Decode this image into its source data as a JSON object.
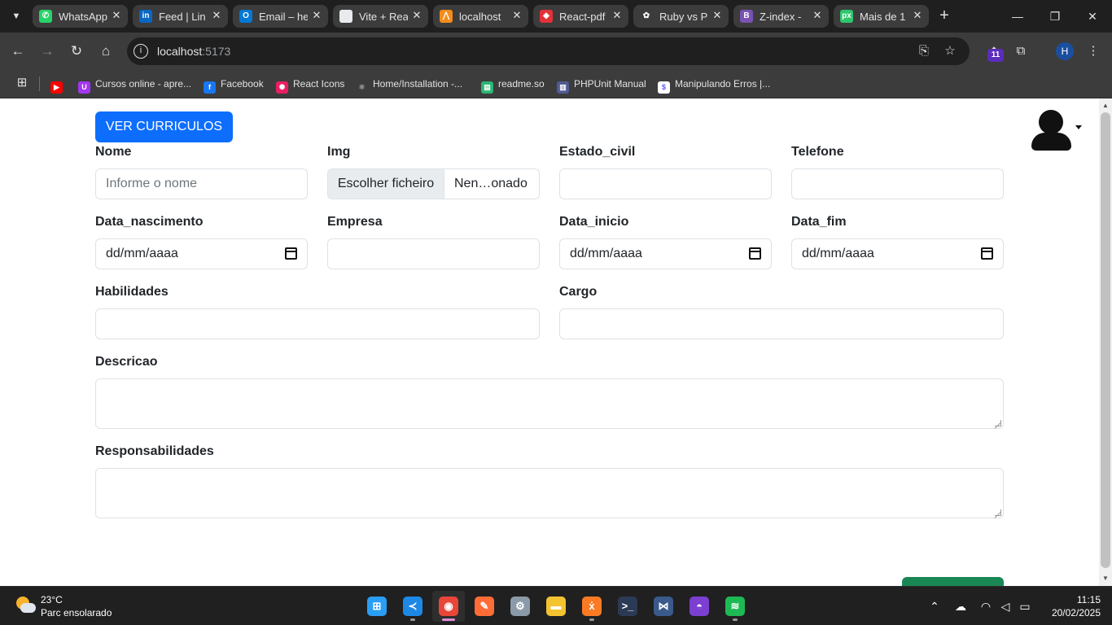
{
  "browser": {
    "tabs": [
      {
        "label": "WhatsApp",
        "icon": "whatsapp-icon",
        "color": "#25d366",
        "glyph": "✆"
      },
      {
        "label": "Feed | Lin",
        "icon": "linkedin-icon",
        "color": "#0a66c2",
        "glyph": "in"
      },
      {
        "label": "Email – he",
        "icon": "outlook-icon",
        "color": "#0078d4",
        "glyph": "O"
      },
      {
        "label": "Vite + Rea",
        "icon": "page-icon",
        "color": "#e8eaed",
        "glyph": ""
      },
      {
        "label": "localhost",
        "icon": "xampp-icon",
        "color": "#f28c1d",
        "glyph": "⋀"
      },
      {
        "label": "React-pdf",
        "icon": "react-pdf-icon",
        "color": "#e23237",
        "glyph": "◆"
      },
      {
        "label": "Ruby vs P",
        "icon": "openai-icon",
        "color": "#3c3c3c",
        "glyph": "✿"
      },
      {
        "label": "Z-index -",
        "icon": "bootstrap-icon",
        "color": "#7952b3",
        "glyph": "B"
      },
      {
        "label": "Mais de 1",
        "icon": "pixabay-icon",
        "color": "#2ec66d",
        "glyph": "px"
      }
    ],
    "url_host": "localhost",
    "url_port": ":5173",
    "extension_badge": "11",
    "profile_initial": "H",
    "bookmarks": [
      {
        "label": "",
        "icon": "youtube-icon",
        "color": "#ff0000",
        "glyph": "▶"
      },
      {
        "label": "Cursos online - apre...",
        "icon": "udemy-icon",
        "color": "#a435f0",
        "glyph": "U"
      },
      {
        "label": "Facebook",
        "icon": "facebook-icon",
        "color": "#1877f2",
        "glyph": "f"
      },
      {
        "label": "React Icons",
        "icon": "react-icons-icon",
        "color": "#e91e63",
        "glyph": "✺"
      },
      {
        "label": "Home/Installation -...",
        "icon": "react-icon",
        "color": "#3c3c3c",
        "glyph": "⚛"
      },
      {
        "label": "readme.so",
        "icon": "readme-icon",
        "color": "#2bb673",
        "glyph": "▤"
      },
      {
        "label": "PHPUnit Manual",
        "icon": "phpunit-icon",
        "color": "#4f5b93",
        "glyph": "▥"
      },
      {
        "label": "Manipulando Erros |...",
        "icon": "stripe-icon",
        "color": "#ffffff",
        "glyph": "$"
      }
    ]
  },
  "page": {
    "ver_curriculos_button": "VER CURRICULOS",
    "fields": {
      "nome": {
        "label": "Nome",
        "placeholder": "Informe o nome"
      },
      "img": {
        "label": "Img",
        "button": "Escolher ficheiro",
        "filename": "Nen…onado"
      },
      "estado_civil": {
        "label": "Estado_civil"
      },
      "telefone": {
        "label": "Telefone"
      },
      "data_nascimento": {
        "label": "Data_nascimento",
        "value": "dd/mm/aaaa"
      },
      "empresa": {
        "label": "Empresa"
      },
      "data_inicio": {
        "label": "Data_inicio",
        "value": "dd/mm/aaaa"
      },
      "data_fim": {
        "label": "Data_fim",
        "value": "dd/mm/aaaa"
      },
      "habilidades": {
        "label": "Habilidades"
      },
      "cargo": {
        "label": "Cargo"
      },
      "descricao": {
        "label": "Descricao"
      },
      "responsabilidades": {
        "label": "Responsabilidades"
      }
    },
    "colors": {
      "primary": "#0d6efd",
      "success": "#198754"
    }
  },
  "taskbar": {
    "weather_temp": "23°C",
    "weather_desc": "Parc ensolarado",
    "apps": [
      {
        "name": "windows-start-icon",
        "color": "#2a9df4",
        "glyph": "⊞"
      },
      {
        "name": "vscode-icon",
        "color": "#1e88e5",
        "glyph": "≺"
      },
      {
        "name": "chrome-icon",
        "color": "#e9463a",
        "glyph": "◉"
      },
      {
        "name": "postman-icon",
        "color": "#ff6c37",
        "glyph": "✎"
      },
      {
        "name": "settings-icon",
        "color": "#8a9aa8",
        "glyph": "⚙"
      },
      {
        "name": "file-explorer-icon",
        "color": "#f4c430",
        "glyph": "▬"
      },
      {
        "name": "xampp-icon",
        "color": "#fb7a24",
        "glyph": "ẋ"
      },
      {
        "name": "powershell-icon",
        "color": "#2b3a55",
        "glyph": ">_"
      },
      {
        "name": "mysql-workbench-icon",
        "color": "#3a5a8c",
        "glyph": "⋈"
      },
      {
        "name": "github-desktop-icon",
        "color": "#7b3fd1",
        "glyph": "◓"
      },
      {
        "name": "spotify-icon",
        "color": "#1db954",
        "glyph": "≋"
      }
    ],
    "time": "11:15",
    "date": "20/02/2025"
  }
}
